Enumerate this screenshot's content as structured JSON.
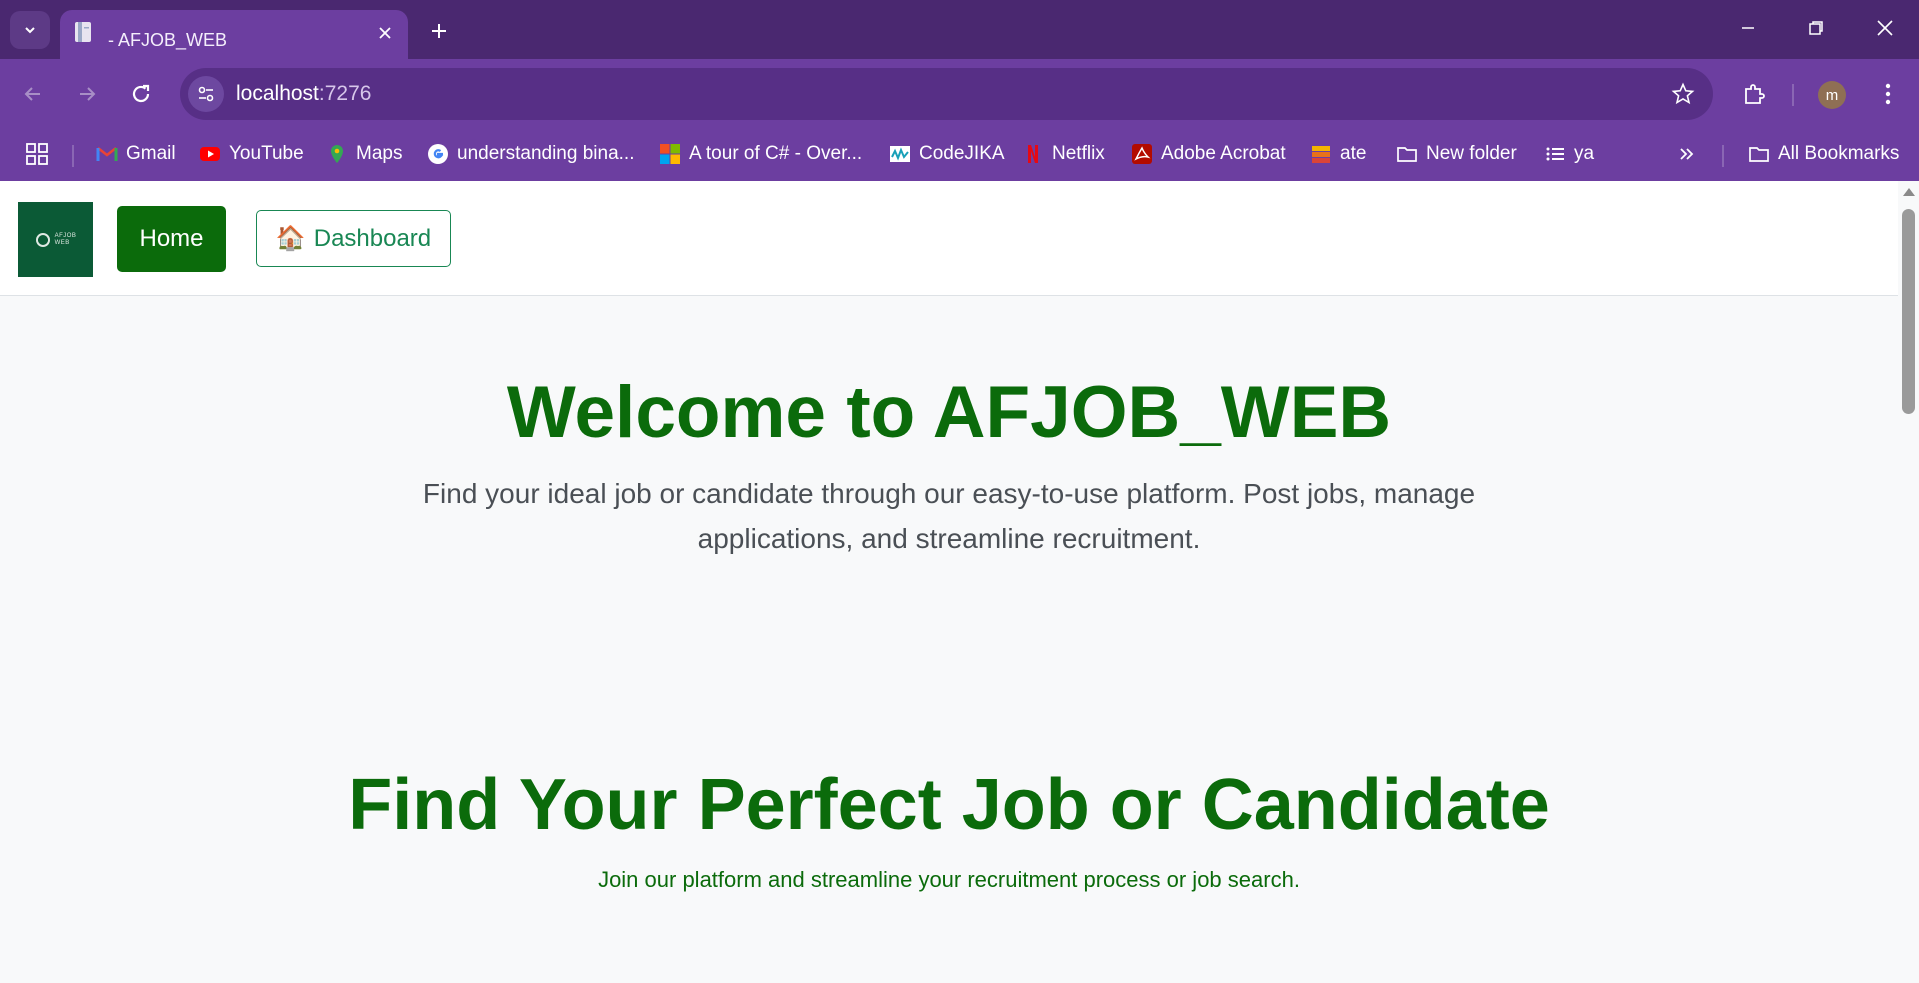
{
  "browser": {
    "tab": {
      "title": "- AFJOB_WEB",
      "favicon": "document-icon"
    },
    "address": {
      "host": "localhost",
      "port": ":7276"
    },
    "profile_initial": "m",
    "bookmarks": [
      {
        "label": "Gmail",
        "icon": "gmail-icon"
      },
      {
        "label": "YouTube",
        "icon": "youtube-icon"
      },
      {
        "label": "Maps",
        "icon": "maps-icon"
      },
      {
        "label": "understanding bina...",
        "icon": "google-icon"
      },
      {
        "label": "A tour of C# - Over...",
        "icon": "microsoft-icon"
      },
      {
        "label": "CodeJIKA",
        "icon": "codejika-icon"
      },
      {
        "label": "Netflix",
        "icon": "netflix-icon"
      },
      {
        "label": "Adobe Acrobat",
        "icon": "acrobat-icon"
      },
      {
        "label": "ate",
        "icon": "stack-icon"
      },
      {
        "label": "New folder",
        "icon": "folder-icon"
      },
      {
        "label": "ya",
        "icon": "list-icon"
      }
    ],
    "all_bookmarks": "All Bookmarks"
  },
  "site": {
    "logo_text_line1": "AFJOB",
    "logo_text_line2": "WEB",
    "nav": {
      "home": "Home",
      "dashboard": "Dashboard"
    },
    "hero": {
      "title": "Welcome to AFJOB_WEB",
      "subtitle": "Find your ideal job or candidate through our easy-to-use platform. Post jobs, manage applications, and streamline recruitment."
    },
    "section": {
      "title": "Find Your Perfect Job or Candidate",
      "subtitle": "Join our platform and streamline your recruitment process or job search."
    }
  },
  "colors": {
    "chrome_dark": "#4a2870",
    "chrome": "#6c3ea0",
    "brand_green": "#0b6b0b",
    "outline_green": "#198754"
  }
}
